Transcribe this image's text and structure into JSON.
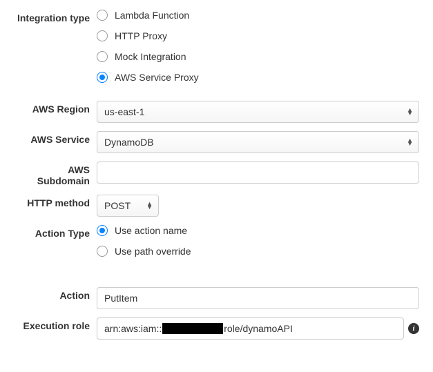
{
  "labels": {
    "integration_type": "Integration type",
    "aws_region": "AWS Region",
    "aws_service": "AWS Service",
    "aws_subdomain": "AWS Subdomain",
    "http_method": "HTTP method",
    "action_type": "Action Type",
    "action": "Action",
    "execution_role": "Execution role"
  },
  "integration_type": {
    "options": [
      "Lambda Function",
      "HTTP Proxy",
      "Mock Integration",
      "AWS Service Proxy"
    ],
    "selected_index": 3
  },
  "aws_region": {
    "value": "us-east-1"
  },
  "aws_service": {
    "value": "DynamoDB"
  },
  "aws_subdomain": {
    "value": ""
  },
  "http_method": {
    "value": "POST"
  },
  "action_type": {
    "options": [
      "Use action name",
      "Use path override"
    ],
    "selected_index": 0
  },
  "action": {
    "value": "PutItem"
  },
  "execution_role": {
    "prefix": "arn:aws:iam::",
    "suffix": "role/dynamoAPI"
  }
}
